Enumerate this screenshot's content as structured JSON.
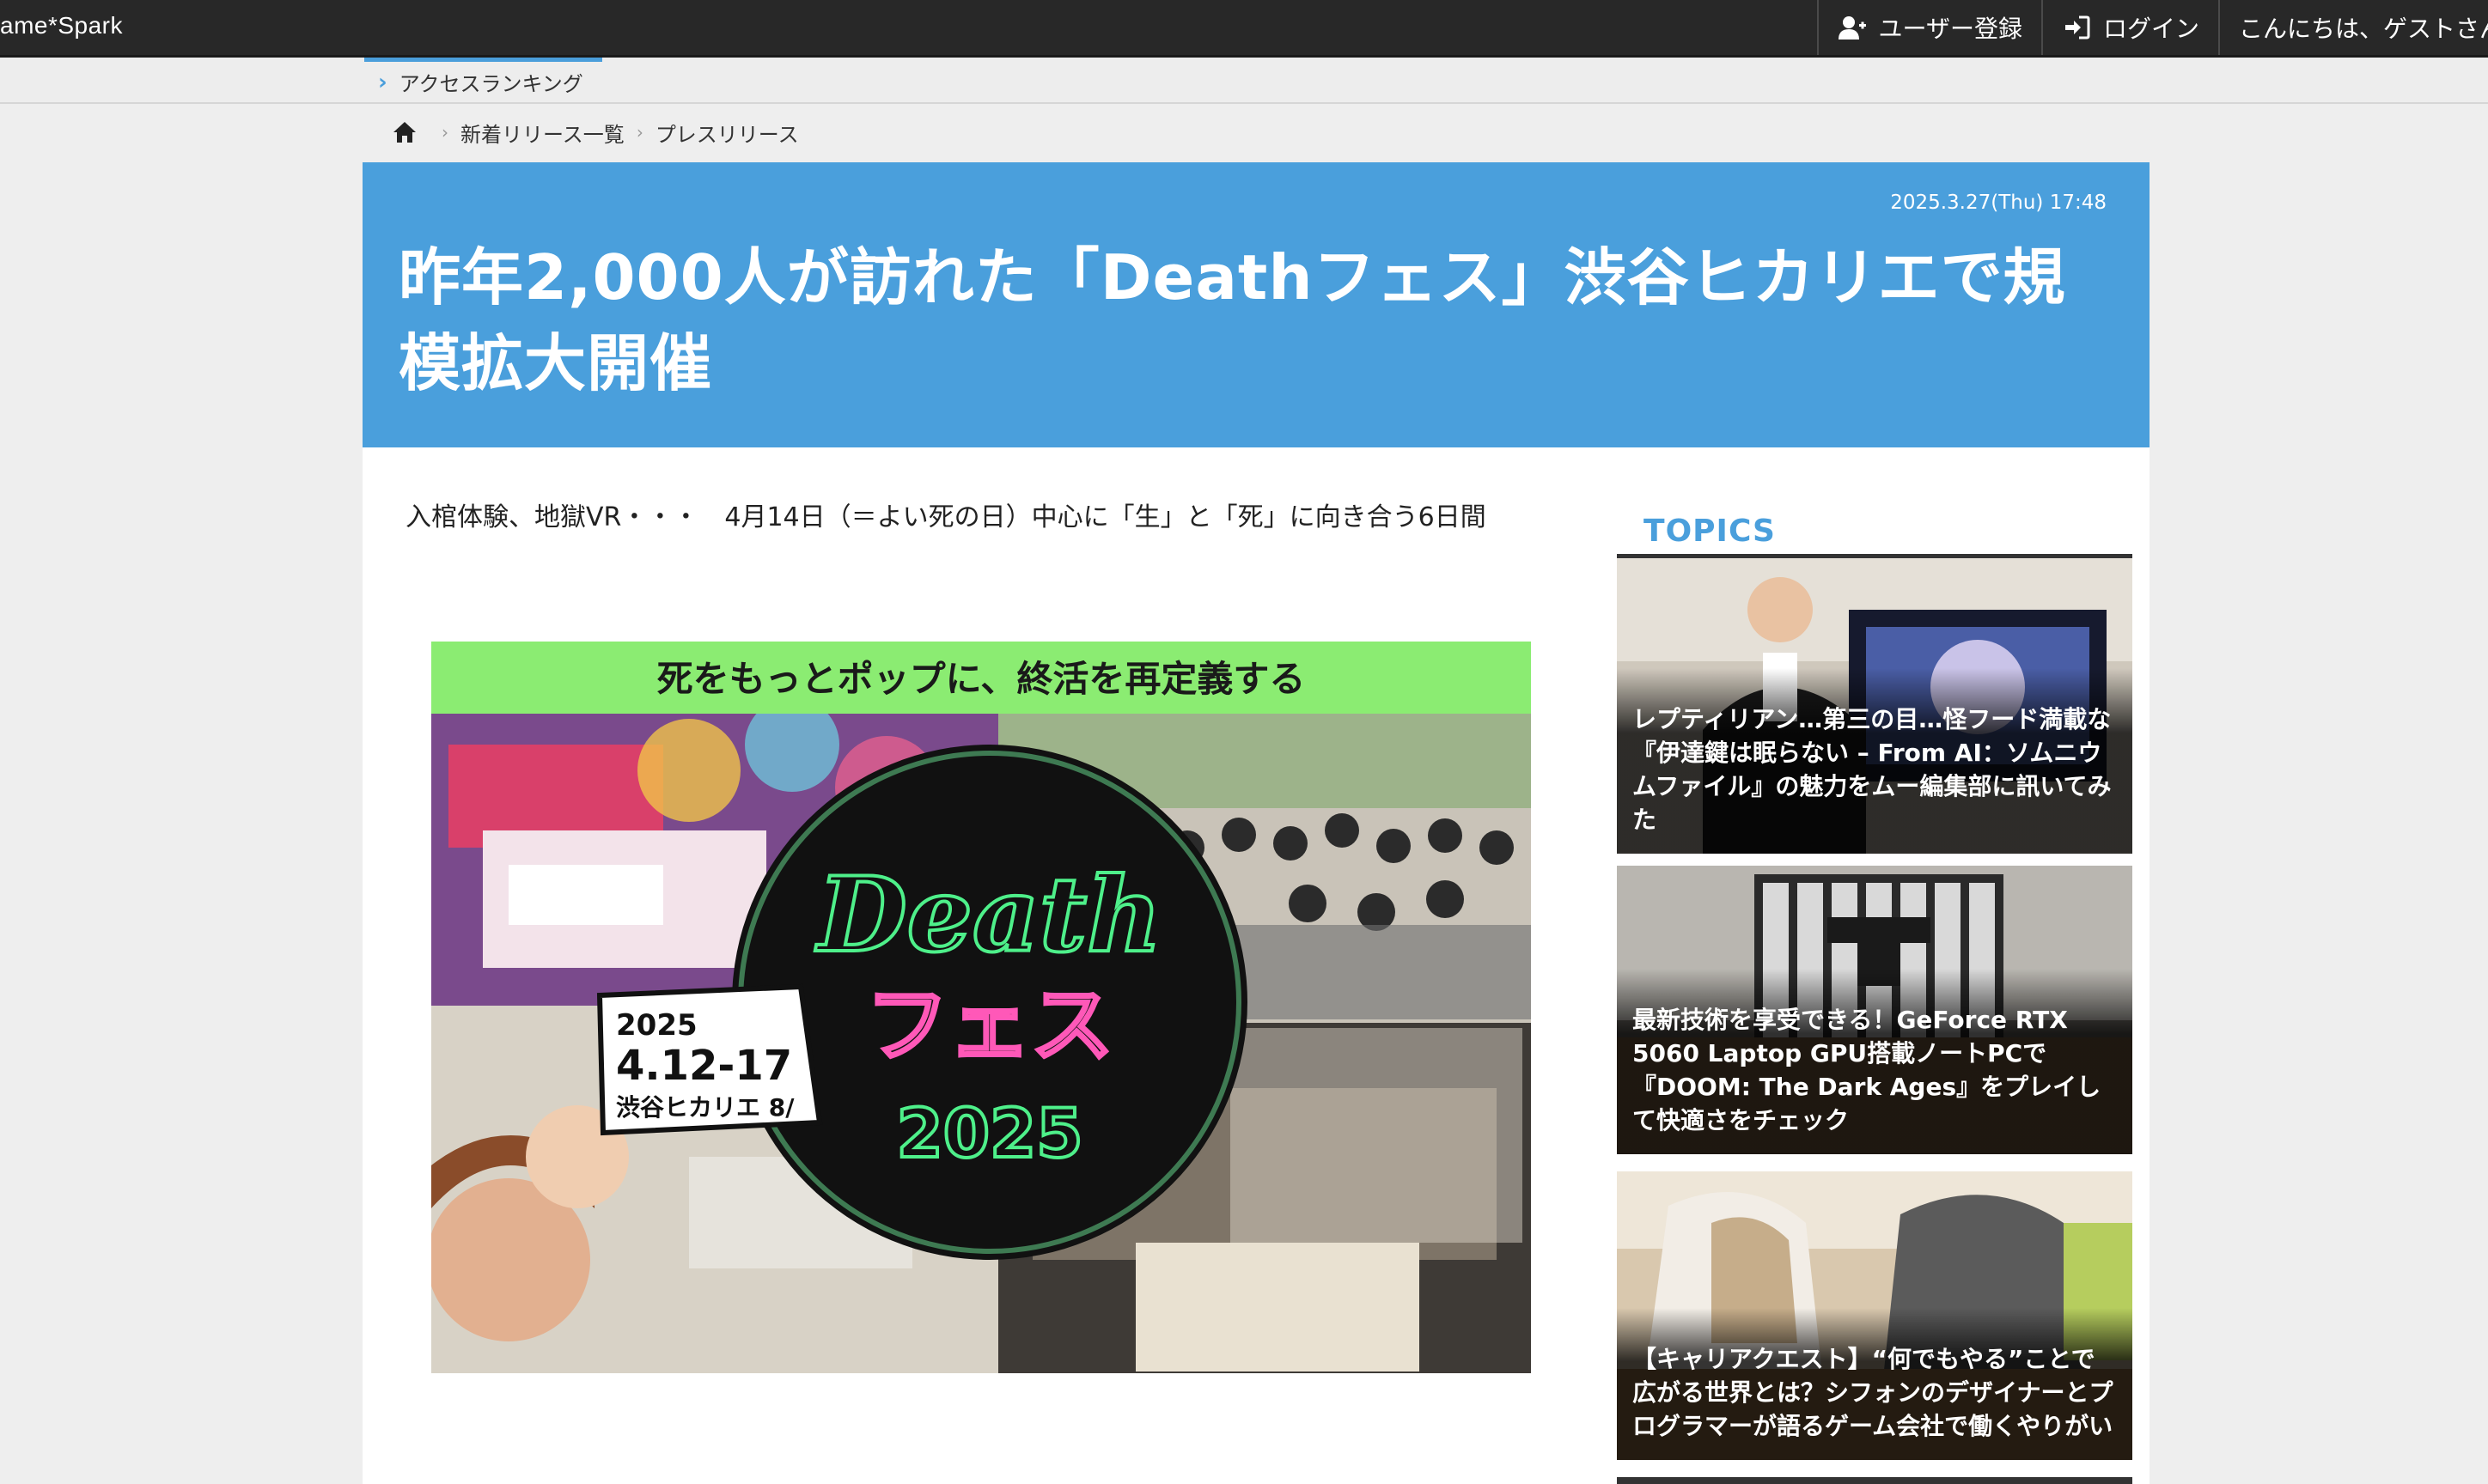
{
  "topbar": {
    "brand": "ame*Spark",
    "register_label": "ユーザー登録",
    "login_label": "ログイン",
    "greeting": "こんにちは、ゲストさん"
  },
  "subnav": {
    "ranking_label": "アクセスランキング"
  },
  "breadcrumb": {
    "items": [
      "新着リリース一覧",
      "プレスリリース"
    ]
  },
  "article": {
    "date": "2025.3.27(Thu) 17:48",
    "title": "昨年2,000人が訪れた「Deathフェス」渋谷ヒカリエで規模拡大開催",
    "lead": "入棺体験、地獄VR・・・　4月14日（＝よい死の日）中心に「生」と「死」に向き合う6日間",
    "image": {
      "banner_text": "死をもっとポップに、終活を再定義する",
      "logo_line1": "Death",
      "logo_line2": "フェス",
      "logo_year": "2025",
      "dates": "2025",
      "dates_range": "4.12-17",
      "venue": "渋谷ヒカリエ 8/"
    }
  },
  "sidebar": {
    "heading": "TOPICS",
    "topics": [
      {
        "caption": "レプティリアン…第三の目…怪フード満載な『伊達鍵は眠らない – From AI：ソムニウムファイル』の魅力をムー編集部に訊いてみた"
      },
      {
        "caption": "最新技術を享受できる！GeForce RTX 5060 Laptop GPU搭載ノートPCで『DOOM: The Dark Ages』をプレイして快適さをチェック"
      },
      {
        "caption": "【キャリアクエスト】“何でもやる”ことで広がる世界とは？シフォンのデザイナーとプログラマーが語るゲーム会社で働くやりがい"
      }
    ]
  },
  "colors": {
    "accent": "#4a9fdc",
    "topbar": "#282828",
    "banner_green": "#8bec72"
  }
}
